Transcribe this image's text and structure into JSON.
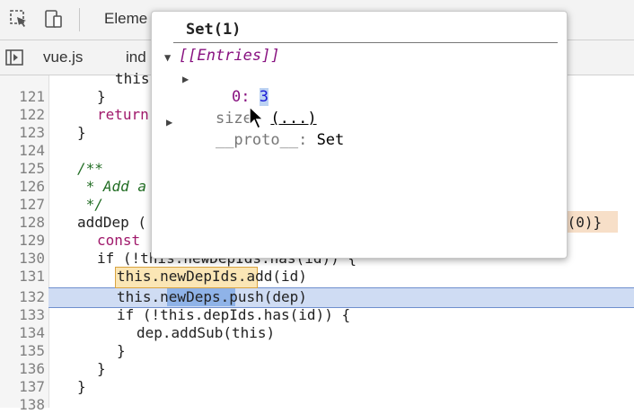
{
  "toolbar": {
    "elements_tab": "Eleme"
  },
  "file_tabs": [
    "vue.js",
    "ind"
  ],
  "code_lines": [
    {
      "num": "121",
      "text": "}"
    },
    {
      "num": "122",
      "text": "return"
    },
    {
      "num": "123",
      "text": "}"
    },
    {
      "num": "124",
      "text": ""
    },
    {
      "num": "125",
      "text": "/**"
    },
    {
      "num": "126",
      "text": " * Add a"
    },
    {
      "num": "127",
      "text": " */"
    },
    {
      "num": "128",
      "text": "addDep ("
    },
    {
      "num": "129",
      "text": "const"
    },
    {
      "num": "130",
      "text": "if (!this.newDepIds.has(id)) {"
    },
    {
      "num": "131",
      "text": "this.newDepIds.add(id)"
    },
    {
      "num": "132",
      "text": "this.newDeps.push(dep)"
    },
    {
      "num": "133",
      "text": "if (!this.depIds.has(id)) {"
    },
    {
      "num": "134",
      "text": "dep.addSub(this)"
    },
    {
      "num": "135",
      "text": "}"
    },
    {
      "num": "136",
      "text": "}"
    },
    {
      "num": "137",
      "text": "}"
    },
    {
      "num": "138",
      "text": ""
    }
  ],
  "code_partial_top": "this",
  "code_right_fragment": "y(0)}",
  "popover": {
    "title": "Set(1)",
    "entries_label": "[[Entries]]",
    "entry_key": "0",
    "entry_value": "3",
    "size_label": "size",
    "size_value": "(...)",
    "proto_label": "__proto__",
    "proto_value": "Set"
  }
}
